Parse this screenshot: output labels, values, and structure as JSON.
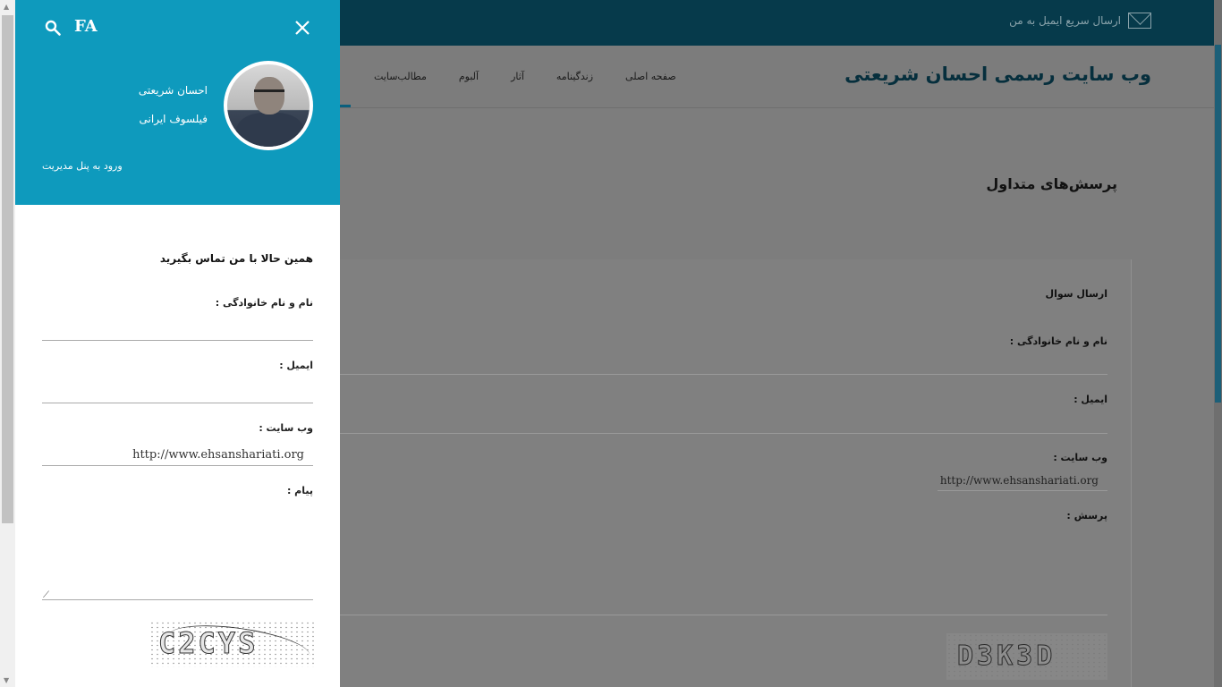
{
  "topbar": {
    "quick_email": "ارسال سریع ایمیل به من"
  },
  "header": {
    "site_title": "وب سایت رسمی احسان شریعتی",
    "nav": [
      "صفحه اصلی",
      "زندگینامه",
      "آثار",
      "آلبوم",
      "مطالب‌سایت"
    ]
  },
  "page": {
    "heading": "پرسش‌های متداول"
  },
  "form": {
    "title": "ارسال سوال",
    "name_label": "نام و نام خانوادگی :",
    "email_label": "ایمیل :",
    "website_label": "وب سایت :",
    "website_value": "http://www.ehsanshariati.org",
    "question_label": "پرسش :",
    "captcha": "D3K3D"
  },
  "drawer": {
    "lang": "FA",
    "name": "احسان شریعتی",
    "role": "فیلسوف ایرانی",
    "admin_link": "ورود به پنل مدیریت",
    "contact_title": "همین حالا با من تماس بگیرید",
    "name_label": "نام و نام خانوادگی :",
    "email_label": "ایمیل :",
    "website_label": "وب سایت :",
    "website_value": "http://www.ehsanshariati.org",
    "message_label": "پیام :",
    "captcha": "C2CYS"
  }
}
